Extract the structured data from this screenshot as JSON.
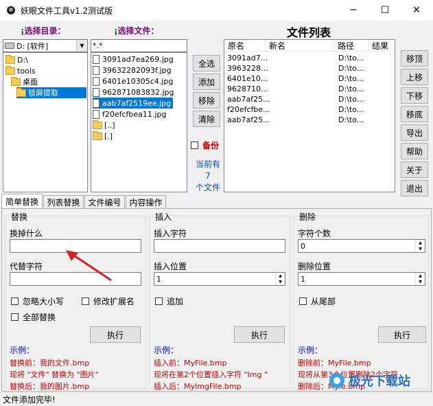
{
  "window": {
    "title": "妖眼文件工具v1.2测试版",
    "min_glyph": "─",
    "max_glyph": "☐",
    "close_glyph": "✕"
  },
  "labels": {
    "choose_dir": "选择目录：",
    "choose_file": "选择文件：",
    "file_list": "文件列表",
    "dot": "¡"
  },
  "drive_combo": {
    "value": "D: [软件]"
  },
  "dir_tree": [
    "D:\\",
    "tools",
    "桌面",
    "锁屏提取"
  ],
  "file_filter": "*.*",
  "files": [
    "3091ad7ea269.jpg",
    "39632282093f.jpg",
    "6401e10305c4.jpg",
    "962871083832.jpg",
    "aab7af2519ee.jpg",
    "f20efcfbea11.jpg",
    "[..]",
    "[.]"
  ],
  "mid_buttons": {
    "select_all": "全选",
    "add": "添加",
    "remove": "移除",
    "clear": "清除"
  },
  "backup": "备份",
  "count_text": {
    "line1": "当前有",
    "line2": "7",
    "line3": "个文件"
  },
  "list_columns": [
    "原名",
    "新名",
    "路径",
    "结果"
  ],
  "list_rows": [
    {
      "orig": "3091ad7...",
      "new": "",
      "path": "D:\\to...",
      "result": ""
    },
    {
      "orig": "3963228...",
      "new": "",
      "path": "D:\\to...",
      "result": ""
    },
    {
      "orig": "6401e10...",
      "new": "",
      "path": "D:\\to...",
      "result": ""
    },
    {
      "orig": "9628710...",
      "new": "",
      "path": "D:\\to...",
      "result": ""
    },
    {
      "orig": "aab7af25...",
      "new": "",
      "path": "D:\\to...",
      "result": ""
    },
    {
      "orig": "f20efcfbe...",
      "new": "",
      "path": "D:\\to...",
      "result": ""
    },
    {
      "orig": "aab7af25...",
      "new": "",
      "path": "D:\\to...",
      "result": ""
    }
  ],
  "right_buttons": [
    "移顶",
    "上移",
    "下移",
    "移底",
    "导出",
    "帮助",
    "关于",
    "退出"
  ],
  "tabs": [
    "简单替换",
    "列表替换",
    "文件编号",
    "内容操作"
  ],
  "replace": {
    "title": "替换",
    "find_label": "换掉什么",
    "find_value": "",
    "with_label": "代替字符",
    "with_value": "",
    "ignore_case": "忽略大小写",
    "change_ext": "修改扩展名",
    "replace_all": "全部替换",
    "exec": "执行",
    "example_title": "示例：",
    "example": [
      "替换前：我的文件.bmp",
      "现将 \"文件\" 替换为 \"图片\"",
      "替换后：我的图片.bmp"
    ]
  },
  "insert": {
    "title": "插入",
    "chars_label": "插入字符",
    "chars_value": "",
    "pos_label": "插入位置",
    "pos_value": "1",
    "append": "追加",
    "exec": "执行",
    "example_title": "示例：",
    "example": [
      "插入前：MyFile.bmp",
      "现将在第2个位置插入字符 \"Img \"",
      "插入后：MyImgFile.bmp"
    ]
  },
  "delete": {
    "title": "删除",
    "count_label": "字符个数",
    "count_value": "0",
    "pos_label": "删除位置",
    "pos_value": "1",
    "from_end": "从尾部",
    "exec": "执行",
    "example_title": "示例：",
    "example": [
      "删除前：MyFile.bmp",
      "现将从第3个位置删除2个字符",
      "删除后：Myle.bmp"
    ]
  },
  "status": "文件添加完毕!",
  "watermark": "极光下载站",
  "colors": {
    "selection": "#0078d7",
    "purple_label": "#800080",
    "example_red": "#c00000",
    "example_blue": "#0000c0",
    "arrow": "#d42020",
    "backup_red": "#c00000"
  }
}
